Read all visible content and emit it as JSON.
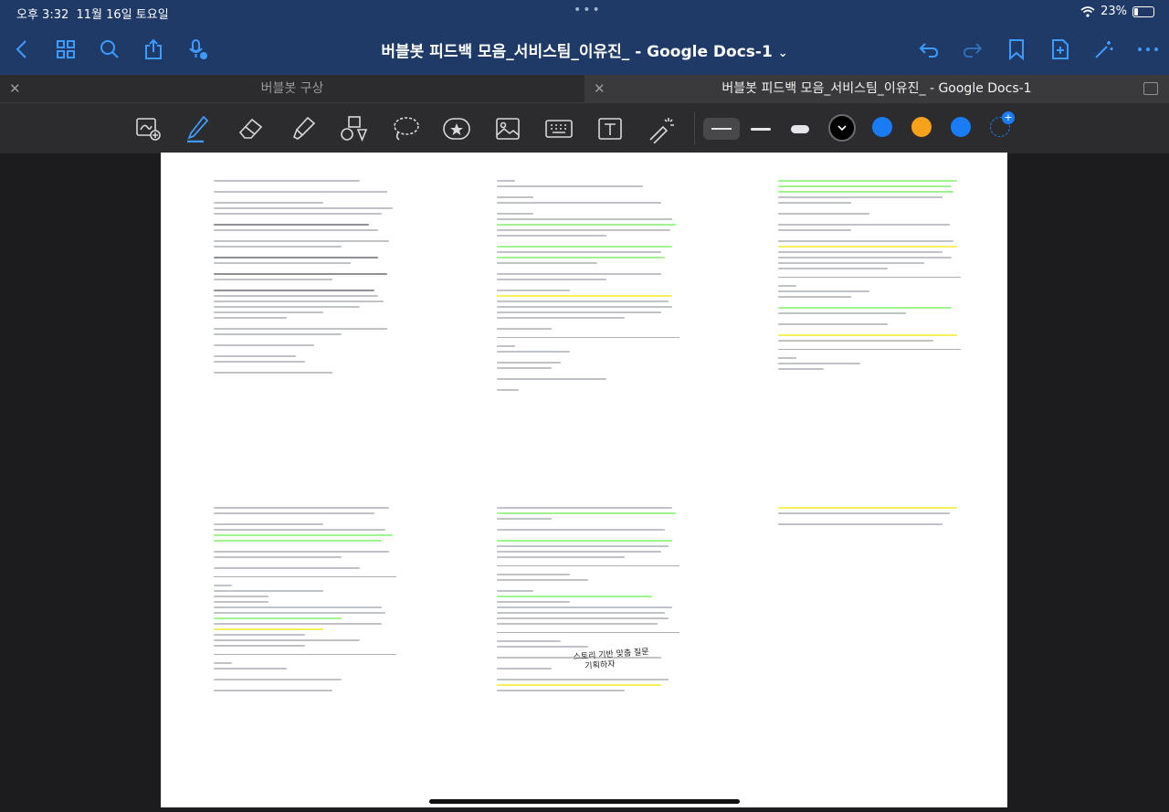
{
  "status": {
    "time": "오후 3:32",
    "date": "11월 16일 토요일",
    "battery": "23%"
  },
  "header": {
    "title": "버블봇 피드백 모음_서비스팀_이유진_ - Google Docs-1",
    "title_chevron": "⌄"
  },
  "tabs": [
    {
      "label": "버블봇 구상"
    },
    {
      "label": "버블봇 피드백 모음_서비스팀_이유진_ - Google Docs-1"
    }
  ],
  "icons": {
    "back": "chevron-left-icon",
    "grid": "grid-icon",
    "search": "search-icon",
    "share": "share-icon",
    "mic": "mic-off-icon",
    "undo": "undo-icon",
    "redo": "redo-icon",
    "bookmark": "bookmark-icon",
    "add_page": "add-page-icon",
    "magic": "magic-icon",
    "more": "more-icon"
  },
  "toolbar_tools": [
    "lasso-image-icon",
    "pen-icon",
    "eraser-icon",
    "highlighter-icon",
    "shapes-icon",
    "lasso-icon",
    "sticker-icon",
    "image-icon",
    "keyboard-icon",
    "text-icon",
    "laser-icon"
  ],
  "colors": {
    "accent": "#3d9bff",
    "bar": "#1f3a66",
    "black_swatch": "#000000",
    "blue1": "#1a7cf5",
    "orange": "#f7a21b",
    "blue2": "#1a7cf5"
  },
  "handwriting": {
    "line1": "스토리 기반 맞춤 질문",
    "line2": "기획하자"
  }
}
